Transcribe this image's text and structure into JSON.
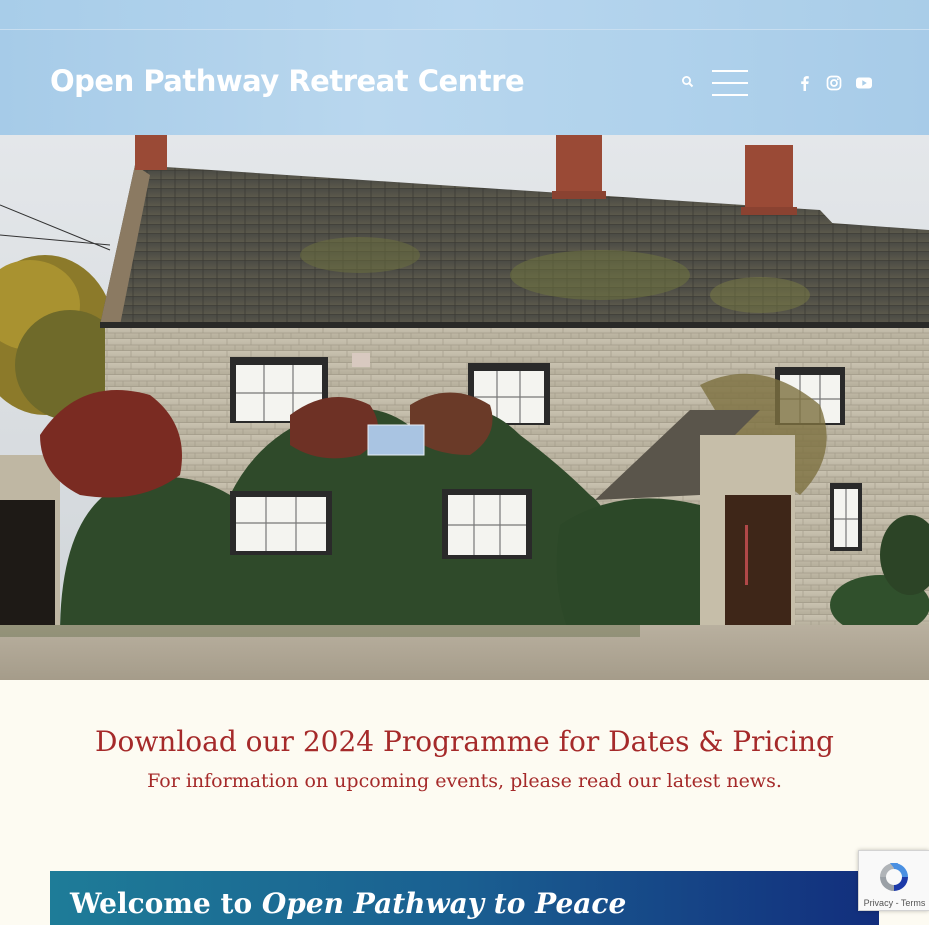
{
  "header": {
    "site_title": "Open Pathway Retreat Centre",
    "search_icon": "search-icon",
    "menu_icon": "hamburger-menu-icon",
    "social": [
      "facebook-icon",
      "instagram-icon",
      "youtube-icon"
    ]
  },
  "hero": {
    "image": "stone-cottage-photo"
  },
  "promo": {
    "title": "Download our 2024 Programme for Dates & Pricing",
    "subtitle": "For information on upcoming events, please read our latest news."
  },
  "welcome": {
    "prefix": "Welcome to",
    "emphasis": "Open Pathway to Peace"
  },
  "recaptcha": {
    "privacy": "Privacy",
    "separator": " - ",
    "terms": "Terms"
  },
  "colors": {
    "header_blue": "#b0d2ec",
    "promo_red": "#a52a2a",
    "banner_start": "#1e7c98",
    "banner_end": "#122e7d",
    "page_bg": "#fdfbf2"
  }
}
